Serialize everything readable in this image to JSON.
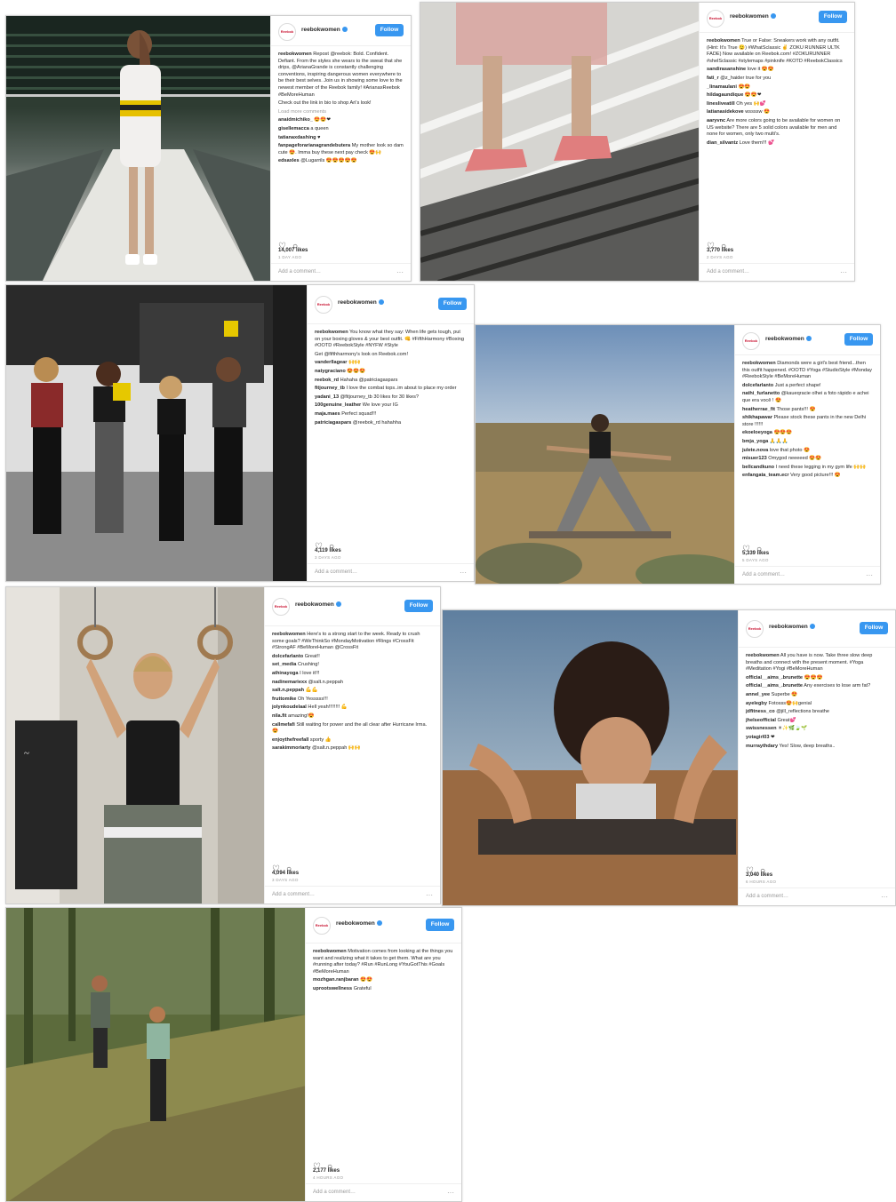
{
  "posts": [
    {
      "username": "reebokwomen",
      "follow_label": "Follow",
      "avatar_text": "Reebok",
      "caption_user": "reebokwomen",
      "caption": "Repost @reebok: Bold. Confident. Defiant. From the styles she wears to the sweat that she drips, @ArianaGrande is constantly challenging conventions, inspiring dangerous women everywhere to be their best selves. Join us in showing some love to the newest member of the Reebok family! #ArianaxReebok #BeMoreHuman",
      "caption_extra": "Check out the link in bio to shop Ari's look!",
      "load_more": "Load more comments",
      "comments": [
        {
          "user": "anaidmichiko_",
          "text": "😍😍❤"
        },
        {
          "user": "gisellemacca",
          "text": "a queen"
        },
        {
          "user": "tatianaxdashing",
          "text": "♥"
        },
        {
          "user": "fanpageforarianagrandebutera",
          "text": "My mother look so dam cute 😍. Imma buy these next pay check 😍🙌"
        },
        {
          "user": "edsaxles",
          "text": "@Lugarrils 😍😍😍😍😍"
        }
      ],
      "likes": "14,007 likes",
      "ago": "1 DAY AGO",
      "add_comment": "Add a comment…"
    },
    {
      "username": "reebokwomen",
      "follow_label": "Follow",
      "avatar_text": "Reebok",
      "caption_user": "reebokwomen",
      "caption": "True or False: Sneakers work with any outfit. (Hint: It's True 😉) #WhatSclassic ✌️ ZOKU RUNNER ULTK FADE) Now available on Reebok.com! #ZOKURUNNER #shelSclassic #stylemaps #pinknife #KOTD #ReebokClassics",
      "caption_extra": "",
      "load_more": "",
      "comments": [
        {
          "user": "sandirasanshine",
          "text": "love it 😍😍"
        },
        {
          "user": "fati_r",
          "text": "@z_haider true for you"
        },
        {
          "user": "_linamaulani",
          "text": "😍😍"
        },
        {
          "user": "hildagaundique",
          "text": "😍😍❤"
        },
        {
          "user": "linesliveatill",
          "text": "Oh yes 🙌💕"
        },
        {
          "user": "latianasidekove",
          "text": "wssssw 😍"
        },
        {
          "user": "aaryvnc",
          "text": "Are more colors going to be available for women on US website? There are 5 solid colors available for men and none for women, only two multi's."
        },
        {
          "user": "dian_silvantz",
          "text": "Love them!!! 💕"
        }
      ],
      "likes": "3,770 likes",
      "ago": "2 DAYS AGO",
      "add_comment": "Add a comment…"
    },
    {
      "username": "reebokwomen",
      "follow_label": "Follow",
      "avatar_text": "Reebok",
      "caption_user": "reebokwomen",
      "caption": "You know what they say: When life gets tough, put on your boxing gloves & your best outfit. 👊 #FifthHarmony #Boxing #OOTD #ReebokStyle #NYFW #Style",
      "caption_extra": "Get @fifthharmony's look on Reebok.com!",
      "load_more": "",
      "comments": [
        {
          "user": "vanderllagear",
          "text": "🙌🙌"
        },
        {
          "user": "natygraciano",
          "text": "😍😍😍"
        },
        {
          "user": "reebok_rd",
          "text": "Hahaha @patriciagaspars"
        },
        {
          "user": "fitjourney_tb",
          "text": "I love the combat tops..im about to place my order"
        },
        {
          "user": "yadani_13",
          "text": "@fitjourney_tb 30 likes for 30 likes?"
        },
        {
          "user": "100genuine_leather",
          "text": "We love your IG"
        },
        {
          "user": "maja.maes",
          "text": "Perfect squad!!!"
        },
        {
          "user": "patriciagaspars",
          "text": "@reebok_rd hahahha"
        }
      ],
      "likes": "4,119 likes",
      "ago": "3 DAYS AGO",
      "add_comment": "Add a comment…"
    },
    {
      "username": "reebokwomen",
      "follow_label": "Follow",
      "avatar_text": "Reebok",
      "caption_user": "reebokwomen",
      "caption": "Diamonds were a girl's best friend...then this outfit happened. #OOTD #Yoga #StudioStyle #Monday #ReebokStyle #BeMoreHuman",
      "caption_extra": "",
      "load_more": "",
      "comments": [
        {
          "user": "dolcefarlanto",
          "text": "Just a perfect shape!"
        },
        {
          "user": "nathi_furlanetto",
          "text": "@kaueqracie olhei a foto rápido e achei que era você ! 😍"
        },
        {
          "user": "heatherrae_fit",
          "text": "Those pants!!! 😍"
        },
        {
          "user": "shikhapawar",
          "text": "Please stock these pants in the new Delhi store !!!!!!"
        },
        {
          "user": "ekoeloeyoga",
          "text": "😍😍😍"
        },
        {
          "user": "bmja_yoga",
          "text": "🙏🙏🙏"
        },
        {
          "user": "julete.nova",
          "text": "love that photo 😍"
        },
        {
          "user": "misuer123",
          "text": "Omygod neeeeed 😍😍"
        },
        {
          "user": "bellcandkuno",
          "text": "I need these legging in my gym life 🙌🙌"
        },
        {
          "user": "enfangata_team.ecr",
          "text": "Very good picture!!! 😍"
        }
      ],
      "likes": "5,339 likes",
      "ago": "5 DAYS AGO",
      "add_comment": "Add a comment…"
    },
    {
      "username": "reebokwomen",
      "follow_label": "Follow",
      "avatar_text": "Reebok",
      "caption_user": "reebokwomen",
      "caption": "Here's to a strong start to the week. Ready to crush some goals? #WeThinkSo #MondayMotivation #Rings #CrossFit #StrongAF #BeMoreHuman @CrossFit",
      "caption_extra": "",
      "load_more": "",
      "comments": [
        {
          "user": "dolcefarlanto",
          "text": "Great!!"
        },
        {
          "user": "set_media",
          "text": "Crushing!"
        },
        {
          "user": "athinayoga",
          "text": "I love it!!!"
        },
        {
          "user": "nadinemariexx",
          "text": "@salt.n.peppah"
        },
        {
          "user": "salt.n.peppah",
          "text": "💪💪"
        },
        {
          "user": "fruttomike",
          "text": "Oh Yesssss!!!"
        },
        {
          "user": "jolynkoudelaal",
          "text": "Hell yeah!!!!!!!! 💪"
        },
        {
          "user": "nila.fit",
          "text": "amazing!😍"
        },
        {
          "user": "callmefafi",
          "text": "Still waiting for power and the all clear after Hurricane Irma. 😍"
        },
        {
          "user": "enjoythefreefall",
          "text": "sporty 👍"
        },
        {
          "user": "sarakimmoriarty",
          "text": "@salt.n.peppah 🙌🙌"
        }
      ],
      "likes": "4,094 likes",
      "ago": "3 DAYS AGO",
      "add_comment": "Add a comment…"
    },
    {
      "username": "reebokwomen",
      "follow_label": "Follow",
      "avatar_text": "Reebok",
      "caption_user": "reebokwomen",
      "caption": "All you have is now. Take three slow deep breaths and connect with the present moment. #Yoga #Meditation #Yogi #BeMoreHuman",
      "caption_extra": "",
      "load_more": "",
      "comments": [
        {
          "user": "official__aims_.brunette",
          "text": "😍😍😍"
        },
        {
          "user": "official__aims_.brunette",
          "text": "Any exercises to lose arm fat?"
        },
        {
          "user": "annel_yee",
          "text": "Superbe 😍"
        },
        {
          "user": "ayelegby",
          "text": "Fotosss😍🙌genial"
        },
        {
          "user": "jdfitness_co",
          "text": "@jill_reflections breathe"
        },
        {
          "user": "jhelseofficial",
          "text": "Great💕"
        },
        {
          "user": "swissnessen",
          "text": "☀✨🌿🍃🌱"
        },
        {
          "user": "yotagirl03",
          "text": "❤"
        },
        {
          "user": "murraythdary",
          "text": "Yes! Slow, deep breaths.."
        }
      ],
      "likes": "3,040 likes",
      "ago": "6 HOURS AGO",
      "add_comment": "Add a comment…"
    },
    {
      "username": "reebokwomen",
      "follow_label": "Follow",
      "avatar_text": "Reebok",
      "caption_user": "reebokwomen",
      "caption": "Motivation comes from looking at the things you want and realizing what it takes to get them. What are you #running after today? #Run #RunLong #YouGotThis #Goals #BeMoreHuman",
      "caption_extra": "",
      "load_more": "",
      "comments": [
        {
          "user": "mozhgan.ranjbaran",
          "text": "😍😍"
        },
        {
          "user": "uprootswellness",
          "text": "Grateful"
        }
      ],
      "likes": "2,177 likes",
      "ago": "4 HOURS AGO",
      "add_comment": "Add a comment…"
    }
  ]
}
